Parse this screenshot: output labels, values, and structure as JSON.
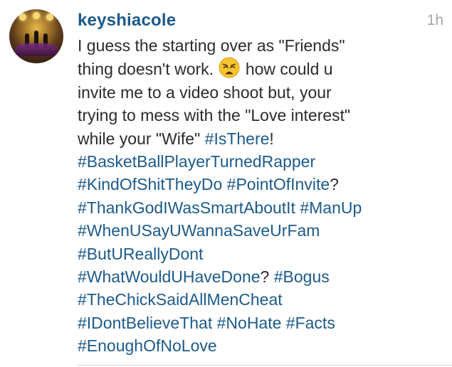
{
  "comment": {
    "username": "keyshiacole",
    "timestamp": "1h",
    "avatar_icon": "profile-photo-concert-stage",
    "lines": [
      [
        {
          "t": "I guess the starting over as \"Friends\""
        }
      ],
      [
        {
          "t": "thing doesn't work. "
        },
        {
          "emoji": "weary-face-emoji"
        },
        {
          "t": " how could u"
        }
      ],
      [
        {
          "t": "invite me to a video shoot but, your"
        }
      ],
      [
        {
          "t": "trying to mess with the \"Love interest\""
        }
      ],
      [
        {
          "t": "while your \"Wife\" "
        },
        {
          "tag": "#IsThere"
        },
        {
          "t": "!"
        }
      ],
      [
        {
          "tag": "#BasketBallPlayerTurnedRapper"
        }
      ],
      [
        {
          "tag": "#KindOfShitTheyDo"
        },
        {
          "t": " "
        },
        {
          "tag": "#PointOfInvite"
        },
        {
          "t": "?"
        }
      ],
      [
        {
          "tag": "#ThankGodIWasSmartAboutIt"
        },
        {
          "t": " "
        },
        {
          "tag": "#ManUp"
        }
      ],
      [
        {
          "tag": "#WhenUSayUWannaSaveUrFam"
        }
      ],
      [
        {
          "tag": "#ButUReallyDont"
        }
      ],
      [
        {
          "tag": "#WhatWouldUHaveDone"
        },
        {
          "t": "? "
        },
        {
          "tag": "#Bogus"
        }
      ],
      [
        {
          "tag": "#TheChickSaidAllMenCheat"
        }
      ],
      [
        {
          "tag": "#IDontBelieveThat"
        },
        {
          "t": "  "
        },
        {
          "tag": "#NoHate"
        },
        {
          "t": " "
        },
        {
          "tag": "#Facts"
        }
      ],
      [
        {
          "tag": "#EnoughOfNoLove"
        }
      ]
    ]
  },
  "colors": {
    "username": "#1c5a8a",
    "hashtag": "#1c5a8a",
    "text": "#2b2b2b",
    "timestamp": "#a6a6a6",
    "divider": "#d9d9d9"
  }
}
